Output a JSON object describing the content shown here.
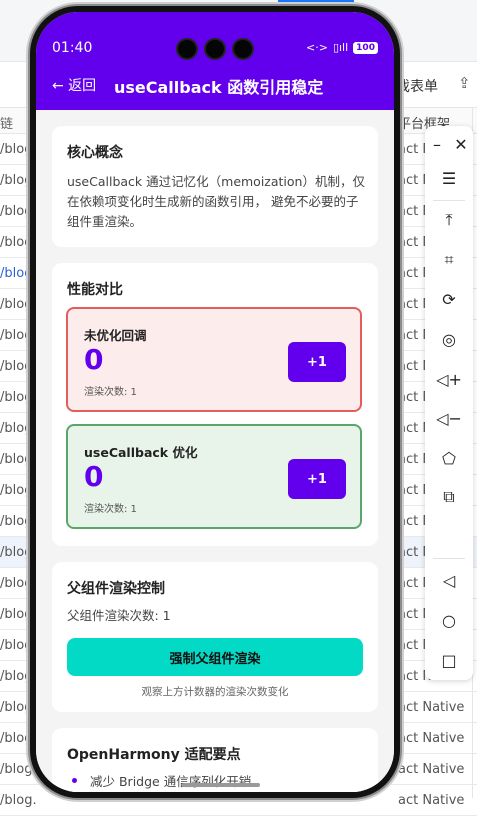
{
  "background": {
    "toolbar_text": "戏表单",
    "header_left": "链",
    "header_right": "平台框架",
    "rows": [
      {
        "left": "/blog",
        "right": "act N",
        "blue": false,
        "sel": false
      },
      {
        "left": "/blog",
        "right": "act N",
        "blue": false,
        "sel": false
      },
      {
        "left": "/blog",
        "right": "act N",
        "blue": false,
        "sel": false
      },
      {
        "left": "/blog",
        "right": "act N",
        "blue": false,
        "sel": false
      },
      {
        "left": "/blog",
        "right": "act N",
        "blue": true,
        "sel": false
      },
      {
        "left": "/blog",
        "right": "act N",
        "blue": false,
        "sel": false
      },
      {
        "left": "/blog",
        "right": "act N",
        "blue": false,
        "sel": false
      },
      {
        "left": "/blog",
        "right": "act N",
        "blue": false,
        "sel": false
      },
      {
        "left": "/blog",
        "right": "act N",
        "blue": false,
        "sel": false
      },
      {
        "left": "/blog",
        "right": "act N",
        "blue": false,
        "sel": false
      },
      {
        "left": "/blog",
        "right": "act N",
        "blue": false,
        "sel": false
      },
      {
        "left": "/blog",
        "right": "act N",
        "blue": false,
        "sel": false
      },
      {
        "left": "/blog",
        "right": "act N",
        "blue": false,
        "sel": false
      },
      {
        "left": "/blog",
        "right": "act N",
        "blue": false,
        "sel": true
      },
      {
        "left": "/blog",
        "right": "act N",
        "blue": false,
        "sel": false
      },
      {
        "left": "/blog",
        "right": "act N",
        "blue": false,
        "sel": false
      },
      {
        "left": "/blog",
        "right": "act N",
        "blue": false,
        "sel": false
      },
      {
        "left": "/blog",
        "right": "act N",
        "blue": false,
        "sel": false
      },
      {
        "left": "/blog",
        "right": "act Native",
        "blue": false,
        "sel": false
      },
      {
        "left": "/blog",
        "right": "act Native",
        "blue": false,
        "sel": false
      },
      {
        "left": "/blog.",
        "right": "act Native",
        "blue": false,
        "sel": false
      },
      {
        "left": "/blog.",
        "right": "act Native",
        "blue": false,
        "sel": false
      }
    ]
  },
  "side_panel": {
    "icons": [
      "minimize-icon",
      "close-icon",
      "menu-icon",
      "pin-top-icon",
      "crop-icon",
      "rotate-icon",
      "screenshot-icon",
      "volume-up-icon",
      "volume-down-icon",
      "eraser-icon",
      "multi-window-icon",
      "back-icon",
      "home-icon",
      "recents-icon"
    ]
  },
  "status_bar": {
    "time": "01:40",
    "signal": "<·>",
    "battery": "100"
  },
  "app_bar": {
    "back_label": "← 返回",
    "title": "useCallback 函数引用稳定"
  },
  "concept": {
    "title": "核心概念",
    "text": "useCallback 通过记忆化（memoization）机制，仅在依赖项变化时生成新的函数引用， 避免不必要的子组件重渲染。"
  },
  "perf": {
    "title": "性能对比",
    "unoptimized": {
      "label": "未优化回调",
      "count": "0",
      "renders": "渲染次数: 1",
      "button": "+1"
    },
    "optimized": {
      "label": "useCallback 优化",
      "count": "0",
      "renders": "渲染次数: 1",
      "button": "+1"
    }
  },
  "parent": {
    "title": "父组件渲染控制",
    "renders": "父组件渲染次数: 1",
    "button": "强制父组件渲染",
    "hint": "观察上方计数器的渲染次数变化"
  },
  "openharmony": {
    "title": "OpenHarmony 适配要点",
    "bullet": "减少 Bridge 通信序列化开销"
  }
}
